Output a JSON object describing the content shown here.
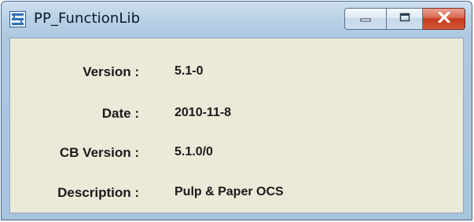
{
  "window": {
    "title": "PP_FunctionLib",
    "controls": {
      "minimize": "minimize",
      "maximize": "maximize",
      "close": "close"
    }
  },
  "fields": [
    {
      "label": "Version :",
      "value": "5.1-0"
    },
    {
      "label": "Date :",
      "value": "2010-11-8"
    },
    {
      "label": "CB Version :",
      "value": "5.1.0/0"
    },
    {
      "label": "Description :",
      "value": "Pulp & Paper OCS"
    }
  ],
  "colors": {
    "content_bg": "#ebe9d8",
    "frame": "#b9d1e6",
    "close_button": "#c4391c"
  },
  "icons": [
    "application-icon",
    "minimize-icon",
    "maximize-icon",
    "close-icon"
  ]
}
